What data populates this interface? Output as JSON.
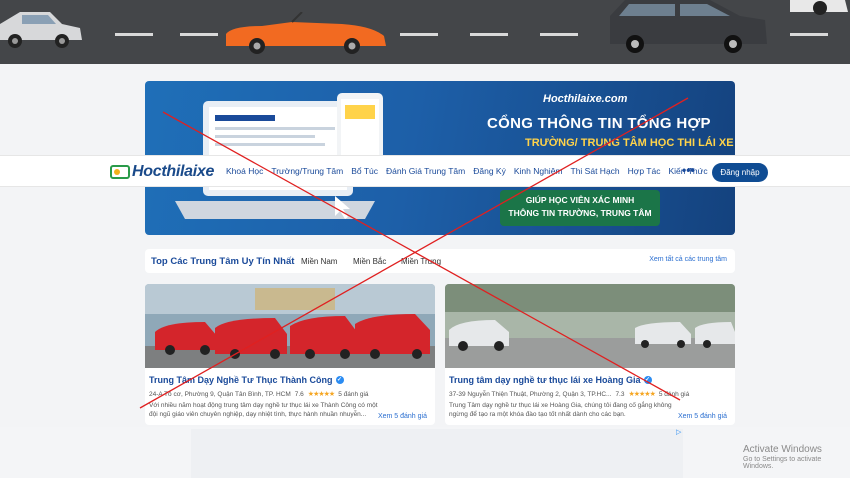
{
  "banner": {
    "brand": "Hocthilaixe.com",
    "title": "CỔNG THÔNG TIN TỔNG HỢP",
    "subtitle": "TRƯỜNG/ TRUNG TÂM HỌC THI LÁI XE",
    "badge_line1": "GIÚP HỌC VIÊN XÁC MINH",
    "badge_line2": "THÔNG TIN TRƯỜNG, TRUNG TÂM"
  },
  "nav": {
    "logo": "Hocthilaixe",
    "items": [
      "Khoá Học",
      "Trường/Trung Tâm",
      "Bổ Túc",
      "Đánh Giá Trung Tâm",
      "Đăng Ký",
      "Kinh Nghiệm",
      "Thi Sát Hạch",
      "Hợp Tác",
      "Kiến Thức"
    ],
    "more": "•••",
    "login": "Đăng nhập"
  },
  "tabs": {
    "title": "Top Các Trung Tâm Uy Tín Nhất",
    "items": [
      "Miền Nam",
      "Miền Bắc",
      "Miền Trung"
    ],
    "view_all": "Xem tất cả các trung tâm"
  },
  "cards": [
    {
      "title": "Trung Tâm Dạy Nghề Tư Thục Thành Công",
      "address": "24-A Tô cơ, Phường 9, Quận Tân Bình, TP. HCM",
      "rating": "7.6",
      "stars": "★★★★★",
      "reviews": "5 đánh giá",
      "desc": "Với nhiều năm hoạt động trung tâm dạy nghề tư thục lái xe Thành Công có một đội ngũ giáo viên chuyên nghiệp, dạy nhiệt tình, thực hành nhuần nhuyễn...",
      "link": "Xem 5 đánh giá"
    },
    {
      "title": "Trung tâm dạy nghề tư thục lái xe Hoàng Gia",
      "address": "37-39 Nguyễn Thiện Thuật, Phường 2, Quận 3, TP.HC...",
      "rating": "7.3",
      "stars": "★★★★★",
      "reviews": "5 đánh giá",
      "desc": "Trung Tâm dạy nghề tư thục lái xe Hoàng Gia, chúng tôi đang cố gắng không ngừng để tạo ra một khóa đào tạo tốt nhất dành cho các bạn.",
      "link": "Xem 5 đánh giá"
    }
  ],
  "ad": {
    "icon": "ad-choices-icon",
    "glyph": "▷"
  },
  "watermark": {
    "line1": "Activate Windows",
    "line2": "Go to Settings to activate Windows."
  },
  "colors": {
    "brand_blue": "#1a4a9a",
    "login_bg": "#0f4c93",
    "overlay_red": "#e02020",
    "star": "#f5a623"
  }
}
